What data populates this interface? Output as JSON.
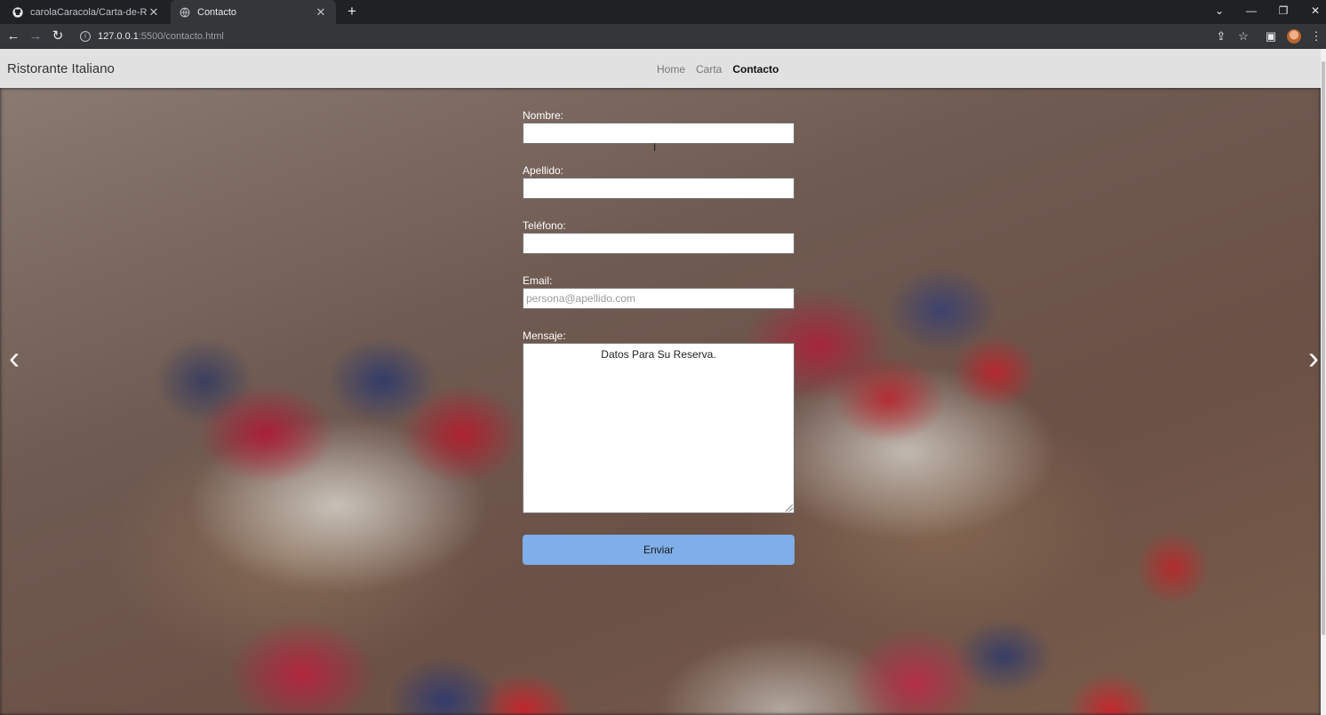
{
  "browser": {
    "tabs": [
      {
        "title": "carolaCaracola/Carta-de-Restaurante",
        "icon": "github-icon",
        "active": false
      },
      {
        "title": "Contacto",
        "icon": "globe-icon",
        "active": true
      }
    ],
    "new_tab_label": "+",
    "url_host": "127.0.0.1",
    "url_rest": ":5500/contacto.html"
  },
  "site": {
    "brand": "Ristorante Italiano",
    "nav": [
      {
        "label": "Home",
        "active": false
      },
      {
        "label": "Carta",
        "active": false
      },
      {
        "label": "Contacto",
        "active": true
      }
    ]
  },
  "form": {
    "nombre_label": "Nombre:",
    "nombre_value": "",
    "apellido_label": "Apellido:",
    "apellido_value": "",
    "telefono_label": "Teléfono:",
    "telefono_value": "",
    "email_label": "Email:",
    "email_placeholder": "persona@apellido.com",
    "mensaje_label": "Mensaje:",
    "mensaje_value": "Datos Para Su Reserva.",
    "submit_label": "Enviar"
  },
  "carousel": {
    "prev_glyph": "‹",
    "next_glyph": "›"
  },
  "colors": {
    "navbar_bg": "#e1e1e1",
    "submit_bg": "#7faee8",
    "browser_dark": "#202124"
  }
}
